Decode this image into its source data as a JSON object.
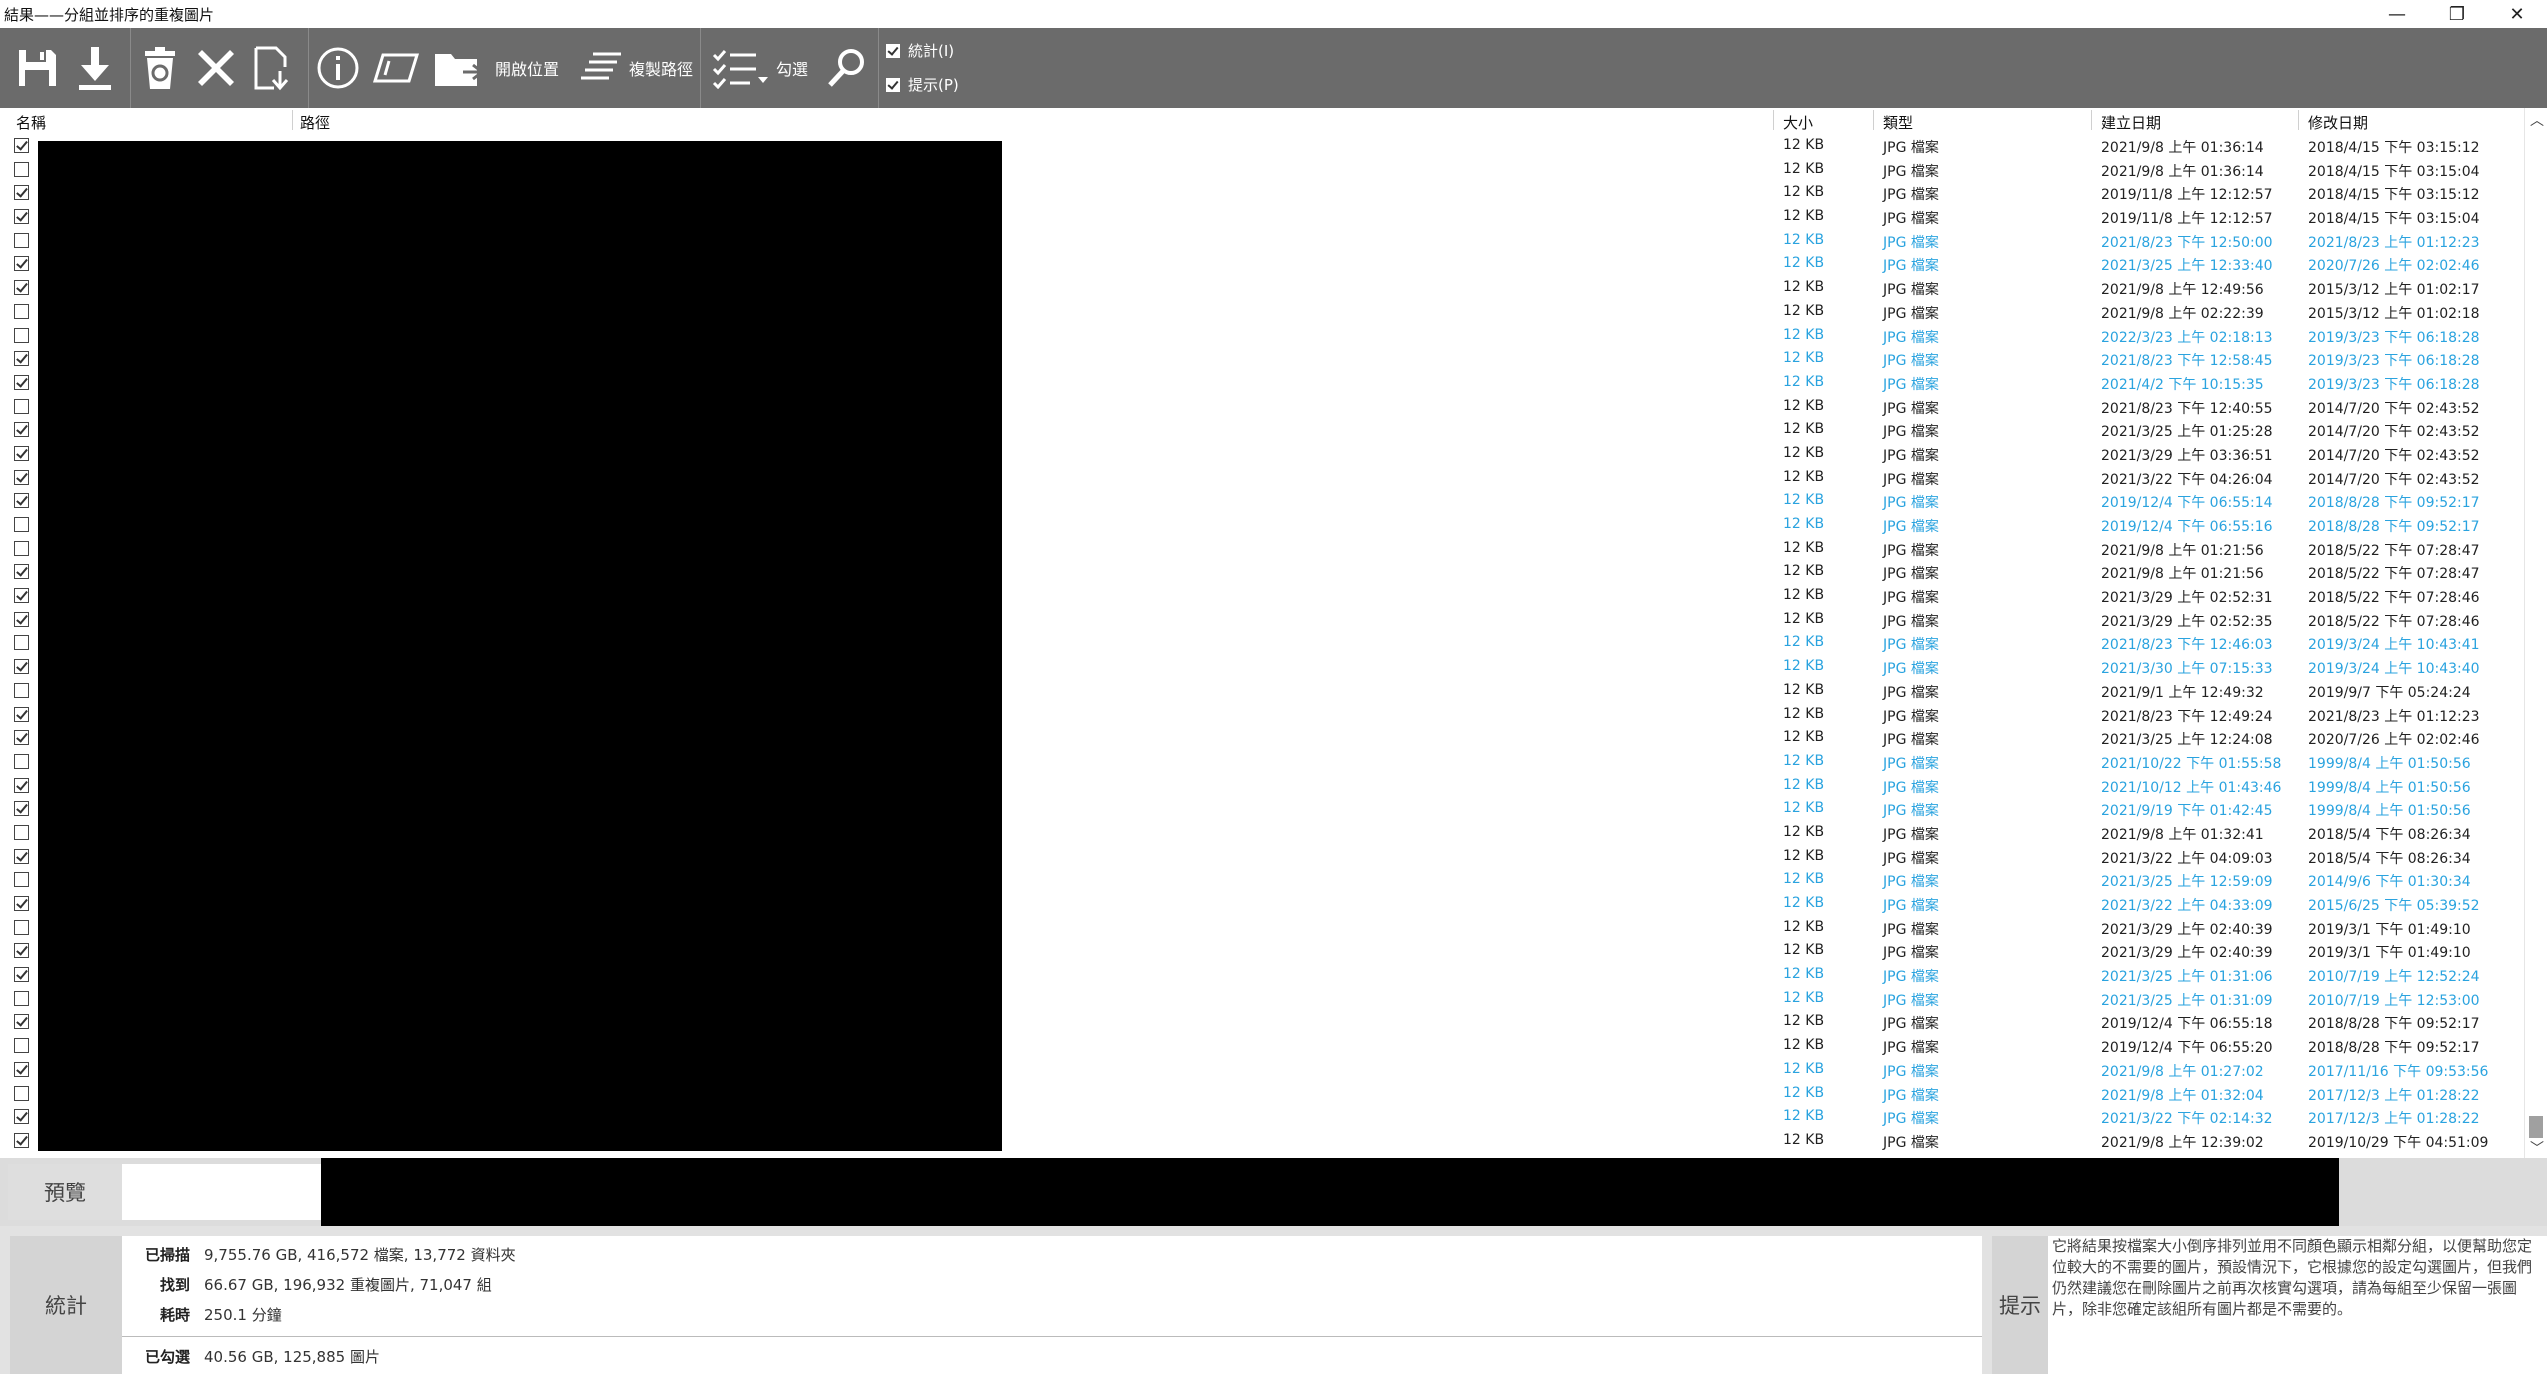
{
  "window": {
    "title": "結果——分組並排序的重複圖片",
    "min": "—",
    "max": "❐",
    "close": "✕"
  },
  "toolbar": {
    "open_location": "開啟位置",
    "copy_path": "複製路徑",
    "check": "勾選",
    "stats_toggle": "統計(I)",
    "hint_toggle": "提示(P)"
  },
  "columns": {
    "name": "名稱",
    "path": "路徑",
    "size": "大小",
    "type": "類型",
    "created": "建立日期",
    "modified": "修改日期"
  },
  "rows": [
    {
      "checked": true,
      "hl": false,
      "size": "12 KB",
      "type": "JPG 檔案",
      "created": "2021/9/8 上午 01:36:14",
      "modified": "2018/4/15 下午 03:15:12"
    },
    {
      "checked": false,
      "hl": false,
      "size": "12 KB",
      "type": "JPG 檔案",
      "created": "2021/9/8 上午 01:36:14",
      "modified": "2018/4/15 下午 03:15:04"
    },
    {
      "checked": true,
      "hl": false,
      "size": "12 KB",
      "type": "JPG 檔案",
      "created": "2019/11/8 上午 12:12:57",
      "modified": "2018/4/15 下午 03:15:12"
    },
    {
      "checked": true,
      "hl": false,
      "size": "12 KB",
      "type": "JPG 檔案",
      "created": "2019/11/8 上午 12:12:57",
      "modified": "2018/4/15 下午 03:15:04"
    },
    {
      "checked": false,
      "hl": true,
      "size": "12 KB",
      "type": "JPG 檔案",
      "created": "2021/8/23 下午 12:50:00",
      "modified": "2021/8/23 上午 01:12:23"
    },
    {
      "checked": true,
      "hl": true,
      "size": "12 KB",
      "type": "JPG 檔案",
      "created": "2021/3/25 上午 12:33:40",
      "modified": "2020/7/26 上午 02:02:46"
    },
    {
      "checked": true,
      "hl": false,
      "size": "12 KB",
      "type": "JPG 檔案",
      "created": "2021/9/8 上午 12:49:56",
      "modified": "2015/3/12 上午 01:02:17"
    },
    {
      "checked": false,
      "hl": false,
      "size": "12 KB",
      "type": "JPG 檔案",
      "created": "2021/9/8 上午 02:22:39",
      "modified": "2015/3/12 上午 01:02:18"
    },
    {
      "checked": false,
      "hl": true,
      "size": "12 KB",
      "type": "JPG 檔案",
      "created": "2022/3/23 上午 02:18:13",
      "modified": "2019/3/23 下午 06:18:28"
    },
    {
      "checked": true,
      "hl": true,
      "size": "12 KB",
      "type": "JPG 檔案",
      "created": "2021/8/23 下午 12:58:45",
      "modified": "2019/3/23 下午 06:18:28"
    },
    {
      "checked": true,
      "hl": true,
      "size": "12 KB",
      "type": "JPG 檔案",
      "created": "2021/4/2 下午 10:15:35",
      "modified": "2019/3/23 下午 06:18:28"
    },
    {
      "checked": false,
      "hl": false,
      "size": "12 KB",
      "type": "JPG 檔案",
      "created": "2021/8/23 下午 12:40:55",
      "modified": "2014/7/20 下午 02:43:52"
    },
    {
      "checked": true,
      "hl": false,
      "size": "12 KB",
      "type": "JPG 檔案",
      "created": "2021/3/25 上午 01:25:28",
      "modified": "2014/7/20 下午 02:43:52"
    },
    {
      "checked": true,
      "hl": false,
      "size": "12 KB",
      "type": "JPG 檔案",
      "created": "2021/3/29 上午 03:36:51",
      "modified": "2014/7/20 下午 02:43:52"
    },
    {
      "checked": true,
      "hl": false,
      "size": "12 KB",
      "type": "JPG 檔案",
      "created": "2021/3/22 下午 04:26:04",
      "modified": "2014/7/20 下午 02:43:52"
    },
    {
      "checked": true,
      "hl": true,
      "size": "12 KB",
      "type": "JPG 檔案",
      "created": "2019/12/4 下午 06:55:14",
      "modified": "2018/8/28 下午 09:52:17"
    },
    {
      "checked": false,
      "hl": true,
      "size": "12 KB",
      "type": "JPG 檔案",
      "created": "2019/12/4 下午 06:55:16",
      "modified": "2018/8/28 下午 09:52:17"
    },
    {
      "checked": false,
      "hl": false,
      "size": "12 KB",
      "type": "JPG 檔案",
      "created": "2021/9/8 上午 01:21:56",
      "modified": "2018/5/22 下午 07:28:47"
    },
    {
      "checked": true,
      "hl": false,
      "size": "12 KB",
      "type": "JPG 檔案",
      "created": "2021/9/8 上午 01:21:56",
      "modified": "2018/5/22 下午 07:28:47"
    },
    {
      "checked": true,
      "hl": false,
      "size": "12 KB",
      "type": "JPG 檔案",
      "created": "2021/3/29 上午 02:52:31",
      "modified": "2018/5/22 下午 07:28:46"
    },
    {
      "checked": true,
      "hl": false,
      "size": "12 KB",
      "type": "JPG 檔案",
      "created": "2021/3/29 上午 02:52:35",
      "modified": "2018/5/22 下午 07:28:46"
    },
    {
      "checked": false,
      "hl": true,
      "size": "12 KB",
      "type": "JPG 檔案",
      "created": "2021/8/23 下午 12:46:03",
      "modified": "2019/3/24 上午 10:43:41"
    },
    {
      "checked": true,
      "hl": true,
      "size": "12 KB",
      "type": "JPG 檔案",
      "created": "2021/3/30 上午 07:15:33",
      "modified": "2019/3/24 上午 10:43:40"
    },
    {
      "checked": false,
      "hl": false,
      "size": "12 KB",
      "type": "JPG 檔案",
      "created": "2021/9/1 上午 12:49:32",
      "modified": "2019/9/7 下午 05:24:24"
    },
    {
      "checked": true,
      "hl": false,
      "size": "12 KB",
      "type": "JPG 檔案",
      "created": "2021/8/23 下午 12:49:24",
      "modified": "2021/8/23 上午 01:12:23"
    },
    {
      "checked": true,
      "hl": false,
      "size": "12 KB",
      "type": "JPG 檔案",
      "created": "2021/3/25 上午 12:24:08",
      "modified": "2020/7/26 上午 02:02:46"
    },
    {
      "checked": false,
      "hl": true,
      "size": "12 KB",
      "type": "JPG 檔案",
      "created": "2021/10/22 下午 01:55:58",
      "modified": "1999/8/4 上午 01:50:56"
    },
    {
      "checked": true,
      "hl": true,
      "size": "12 KB",
      "type": "JPG 檔案",
      "created": "2021/10/12 上午 01:43:46",
      "modified": "1999/8/4 上午 01:50:56"
    },
    {
      "checked": true,
      "hl": true,
      "size": "12 KB",
      "type": "JPG 檔案",
      "created": "2021/9/19 下午 01:42:45",
      "modified": "1999/8/4 上午 01:50:56"
    },
    {
      "checked": false,
      "hl": false,
      "size": "12 KB",
      "type": "JPG 檔案",
      "created": "2021/9/8 上午 01:32:41",
      "modified": "2018/5/4 下午 08:26:34"
    },
    {
      "checked": true,
      "hl": false,
      "size": "12 KB",
      "type": "JPG 檔案",
      "created": "2021/3/22 上午 04:09:03",
      "modified": "2018/5/4 下午 08:26:34"
    },
    {
      "checked": false,
      "hl": true,
      "size": "12 KB",
      "type": "JPG 檔案",
      "created": "2021/3/25 上午 12:59:09",
      "modified": "2014/9/6 下午 01:30:34"
    },
    {
      "checked": true,
      "hl": true,
      "size": "12 KB",
      "type": "JPG 檔案",
      "created": "2021/3/22 上午 04:33:09",
      "modified": "2015/6/25 下午 05:39:52"
    },
    {
      "checked": false,
      "hl": false,
      "size": "12 KB",
      "type": "JPG 檔案",
      "created": "2021/3/29 上午 02:40:39",
      "modified": "2019/3/1 下午 01:49:10"
    },
    {
      "checked": true,
      "hl": false,
      "size": "12 KB",
      "type": "JPG 檔案",
      "created": "2021/3/29 上午 02:40:39",
      "modified": "2019/3/1 下午 01:49:10"
    },
    {
      "checked": true,
      "hl": true,
      "size": "12 KB",
      "type": "JPG 檔案",
      "created": "2021/3/25 上午 01:31:06",
      "modified": "2010/7/19 上午 12:52:24"
    },
    {
      "checked": false,
      "hl": true,
      "size": "12 KB",
      "type": "JPG 檔案",
      "created": "2021/3/25 上午 01:31:09",
      "modified": "2010/7/19 上午 12:53:00"
    },
    {
      "checked": true,
      "hl": false,
      "size": "12 KB",
      "type": "JPG 檔案",
      "created": "2019/12/4 下午 06:55:18",
      "modified": "2018/8/28 下午 09:52:17"
    },
    {
      "checked": false,
      "hl": false,
      "size": "12 KB",
      "type": "JPG 檔案",
      "created": "2019/12/4 下午 06:55:20",
      "modified": "2018/8/28 下午 09:52:17"
    },
    {
      "checked": true,
      "hl": true,
      "size": "12 KB",
      "type": "JPG 檔案",
      "created": "2021/9/8 上午 01:27:02",
      "modified": "2017/11/16 下午 09:53:56"
    },
    {
      "checked": false,
      "hl": true,
      "size": "12 KB",
      "type": "JPG 檔案",
      "created": "2021/9/8 上午 01:32:04",
      "modified": "2017/12/3 上午 01:28:22"
    },
    {
      "checked": true,
      "hl": true,
      "size": "12 KB",
      "type": "JPG 檔案",
      "created": "2021/3/22 下午 02:14:32",
      "modified": "2017/12/3 上午 01:28:22"
    },
    {
      "checked": true,
      "hl": false,
      "size": "12 KB",
      "type": "JPG 檔案",
      "created": "2021/9/8 上午 12:39:02",
      "modified": "2019/10/29 下午 04:51:09"
    }
  ],
  "preview": {
    "label": "預覽"
  },
  "stats": {
    "label": "統計",
    "scanned_k": "已掃描",
    "scanned_v": "9,755.76 GB, 416,572 檔案, 13,772 資料夾",
    "found_k": "找到",
    "found_v": "66.67 GB, 196,932 重複圖片, 71,047 組",
    "elapsed_k": "耗時",
    "elapsed_v": "250.1 分鐘",
    "checked_k": "已勾選",
    "checked_v": "40.56 GB, 125,885 圖片"
  },
  "hint": {
    "label": "提示",
    "text": "它將結果按檔案大小倒序排列並用不同顏色顯示相鄰分組，以便幫助您定位較大的不需要的圖片，預設情況下，它根據您的設定勾選圖片，但我們仍然建議您在刪除圖片之前再次核實勾選項，請為每組至少保留一張圖片，除非您確定該組所有圖片都是不需要的。"
  },
  "colors": {
    "highlight": "#2aa3df",
    "toolbar": "#6b6b6b"
  }
}
